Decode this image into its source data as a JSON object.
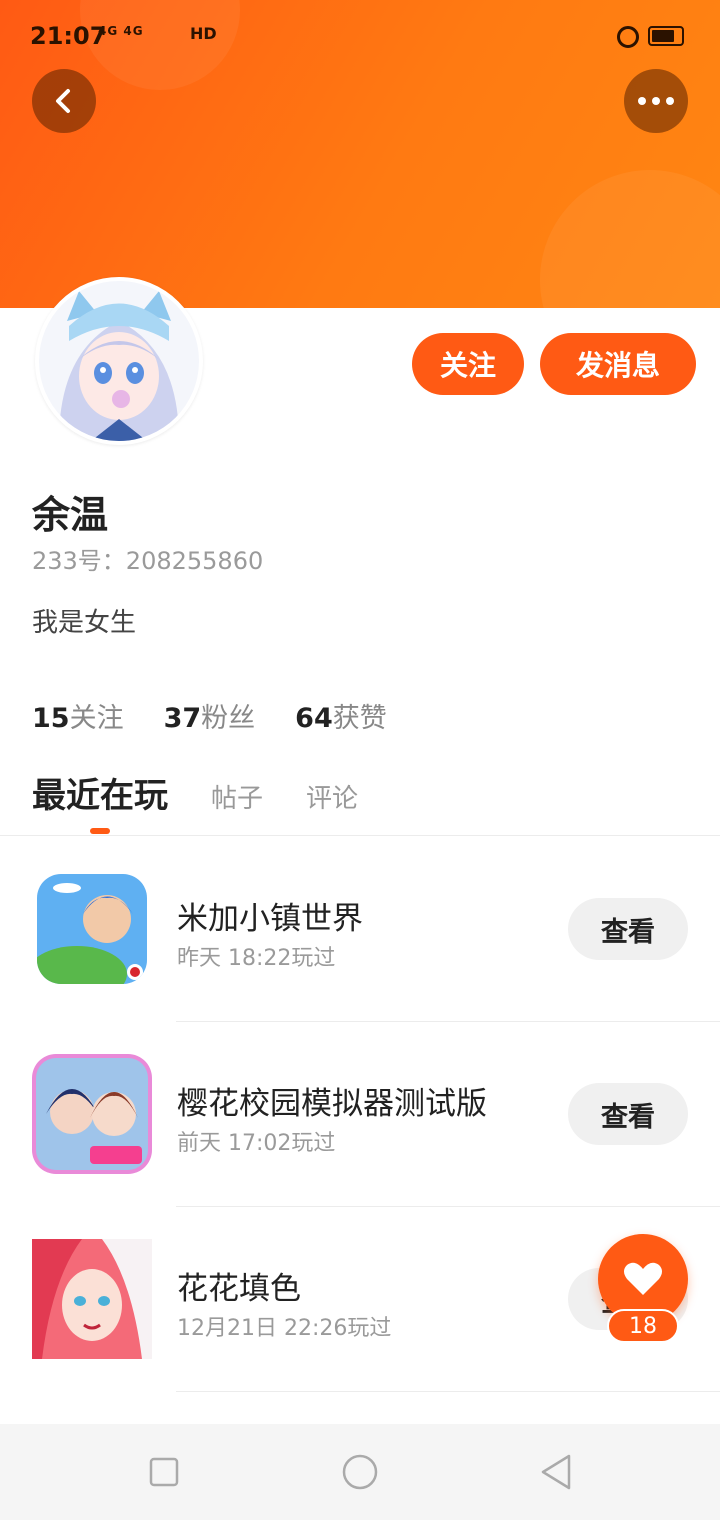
{
  "status_bar": {
    "time": "21:07",
    "signal": "4G 4G",
    "hd": "HD"
  },
  "profile": {
    "name": "余温",
    "id_text": "233号：208255860",
    "bio": "我是女生",
    "follow_label": "关注",
    "message_label": "发消息"
  },
  "stats": [
    {
      "value": "15",
      "label": "关注"
    },
    {
      "value": "37",
      "label": "粉丝"
    },
    {
      "value": "64",
      "label": "获赞"
    }
  ],
  "tabs": [
    "最近在玩",
    "帖子",
    "评论"
  ],
  "games": [
    {
      "name": "米加小镇世界",
      "played": "昨天 18:22玩过",
      "action": "查看"
    },
    {
      "name": "樱花校园模拟器测试版",
      "played": "前天 17:02玩过",
      "action": "查看"
    },
    {
      "name": "花花填色",
      "played": "12月21日 22:26玩过",
      "action": "查看"
    }
  ],
  "likes": {
    "count": "18"
  },
  "colors": {
    "accent": "#ff5a14",
    "header_end": "#ff8612"
  }
}
